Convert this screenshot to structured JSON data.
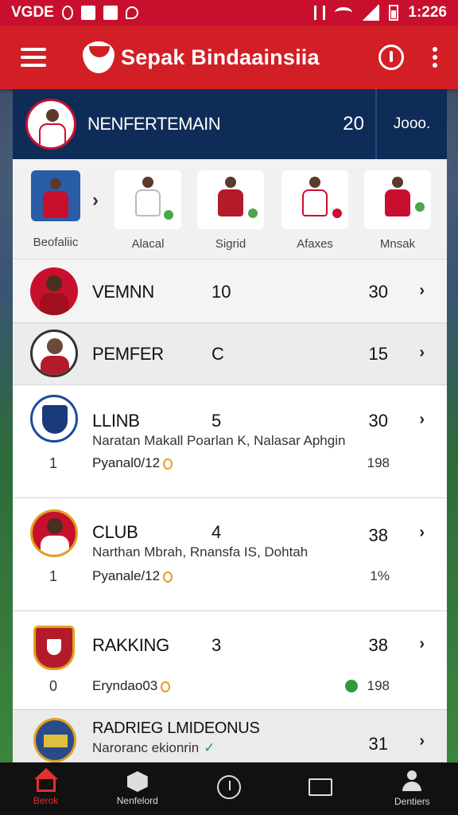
{
  "status_bar": {
    "carrier": "VGDE",
    "time": "1:226",
    "icons": [
      "s-icon",
      "m-icon",
      "image-icon",
      "location-icon",
      "nfc-icon",
      "wifi-icon",
      "signal-icon",
      "battery-icon"
    ]
  },
  "app_bar": {
    "title": "Sepak Bindaainsiia",
    "icons": [
      "menu-icon",
      "app-logo",
      "info-icon",
      "more-icon"
    ]
  },
  "header": {
    "label": "NENFERTEMAIN",
    "count": "20",
    "link": "Jooo."
  },
  "categories": [
    {
      "label": "Beofaliic",
      "icon": "player-icon"
    },
    {
      "label": "Alacal",
      "icon": "player-icon"
    },
    {
      "label": "Sigrid",
      "icon": "player-icon"
    },
    {
      "label": "Afaxes",
      "icon": "player-icon"
    },
    {
      "label": "Mnsak",
      "icon": "player-icon"
    }
  ],
  "rows": [
    {
      "name": "VEMNN",
      "mid": "10",
      "score": "30"
    },
    {
      "name": "PEMFER",
      "mid": "C",
      "score": "15"
    },
    {
      "name": "LLINB",
      "mid": "5",
      "score": "30",
      "sub": "Naratan Makall Poarlan K, Nalasar Aphgin",
      "rank": "1",
      "detail": "Pyanal0/12",
      "pct": "198"
    },
    {
      "name": "CLUB",
      "mid": "4",
      "score": "38",
      "sub": "Narthan Mbrah, Rnansfa IS, Dohtah",
      "rank": "1",
      "detail": "Pyanale/12",
      "pct": "1%"
    },
    {
      "name": "RAKKING",
      "mid": "3",
      "score": "38",
      "rank": "0",
      "detail": "Eryndao03",
      "pct": "198"
    },
    {
      "name": "RADRIEG LMIDEONUS",
      "score": "31",
      "sub": "Naroranc ekionrin"
    }
  ],
  "bottom_nav": [
    {
      "label": "Berok",
      "active": true
    },
    {
      "label": "Nenfelord",
      "active": false
    },
    {
      "label": "",
      "active": false
    },
    {
      "label": "",
      "active": false
    },
    {
      "label": "Dentiers",
      "active": false
    }
  ],
  "colors": {
    "brand_red": "#d21f26",
    "header_navy": "#0f2c58",
    "accent_green": "#2e9b3c"
  }
}
